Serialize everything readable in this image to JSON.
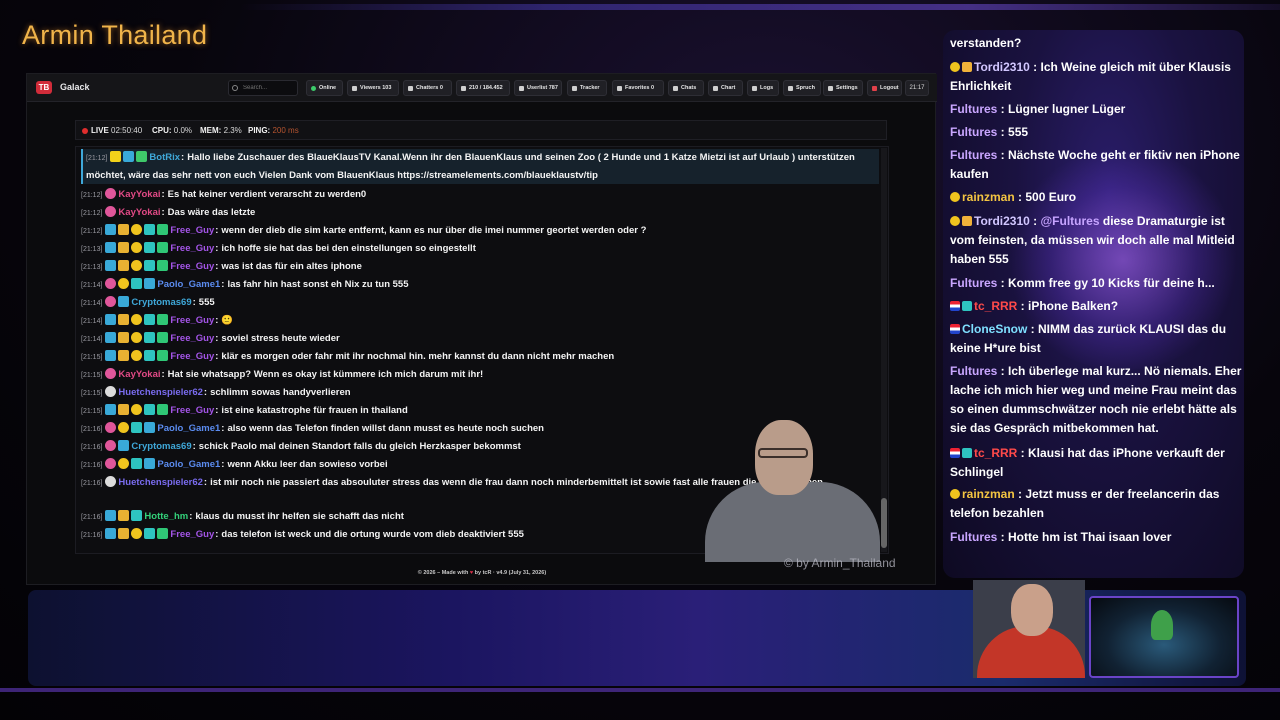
{
  "channel_title": "Armin Thailand",
  "app": {
    "brand": "Galack",
    "search_placeholder": "Search...",
    "toolbar": [
      {
        "label": "Online"
      },
      {
        "label": "Viewers 103"
      },
      {
        "label": "Chatters 0"
      },
      {
        "label": "210 / 184.452"
      },
      {
        "label": "Userlist 787"
      },
      {
        "label": "Tracker"
      },
      {
        "label": "Favorites 0"
      },
      {
        "label": "Chats"
      },
      {
        "label": "Chart"
      },
      {
        "label": "Logs"
      },
      {
        "label": "Spruch"
      },
      {
        "label": "Settings"
      },
      {
        "label": "Logout"
      }
    ],
    "clock": "21:17",
    "status": {
      "live_label": "LIVE",
      "live_value": "02:50:40",
      "cpu_label": "CPU:",
      "cpu_value": "0.0%",
      "mem_label": "MEM:",
      "mem_value": "2.3%",
      "ping_label": "PING:",
      "ping_value": "200 ms"
    },
    "messages": [
      {
        "time": "[21:12]",
        "user": "BotRix",
        "text": "Hallo liebe Zuschauer des BlaueKlausTV Kanal.Wenn ihr den BlauenKlaus und seinen Zoo ( 2 Hunde und 1 Katze Mietzi ist auf Urlaub ) unterstützen möchtet, wäre das sehr nett von euch Vielen Dank vom BlauenKlaus https://streamelements.com/blaueklaustv/tip",
        "color": "#3fa8d9"
      },
      {
        "time": "[21:12]",
        "user": "KayYokai",
        "text": "Es hat keiner verdient verarscht zu werden0",
        "color": "#e24a86"
      },
      {
        "time": "[21:12]",
        "user": "KayYokai",
        "text": "Das wäre das letzte",
        "color": "#e24a86"
      },
      {
        "time": "[21:12]",
        "user": "Free_Guy",
        "text": "wenn der dieb die sim karte entfernt, kann es nur über die imei nummer geortet werden oder ?",
        "color": "#a455e8"
      },
      {
        "time": "[21:13]",
        "user": "Free_Guy",
        "text": "ich hoffe sie hat das bei den einstellungen so eingestellt",
        "color": "#a455e8"
      },
      {
        "time": "[21:13]",
        "user": "Free_Guy",
        "text": "was ist das für ein altes iphone",
        "color": "#a455e8"
      },
      {
        "time": "[21:14]",
        "user": "Paolo_Game1",
        "text": "las fahr hin hast sonst eh Nix zu tun 555",
        "color": "#5b8cf0"
      },
      {
        "time": "[21:14]",
        "user": "Cryptomas69",
        "text": "555",
        "color": "#3fa8d9"
      },
      {
        "time": "[21:14]",
        "user": "Free_Guy",
        "text": "🙂",
        "color": "#a455e8"
      },
      {
        "time": "[21:14]",
        "user": "Free_Guy",
        "text": "soviel stress heute wieder",
        "color": "#a455e8"
      },
      {
        "time": "[21:15]",
        "user": "Free_Guy",
        "text": "klär es morgen oder fahr mit ihr nochmal hin. mehr kannst du dann nicht mehr machen",
        "color": "#a455e8"
      },
      {
        "time": "[21:15]",
        "user": "KayYokai",
        "text": "Hat sie whatsapp? Wenn es okay ist kümmere ich mich darum mit ihr!",
        "color": "#e24a86"
      },
      {
        "time": "[21:15]",
        "user": "Huetchenspieler62",
        "text": "schlimm sowas handyverlieren",
        "color": "#7a6cf0"
      },
      {
        "time": "[21:15]",
        "user": "Free_Guy",
        "text": "ist eine katastrophe für frauen in thailand",
        "color": "#a455e8"
      },
      {
        "time": "[21:16]",
        "user": "Paolo_Game1",
        "text": "also wenn das Telefon finden willst dann musst es heute noch suchen",
        "color": "#5b8cf0"
      },
      {
        "time": "[21:16]",
        "user": "Cryptomas69",
        "text": "schick Paolo mal deinen Standort falls du gleich Herzkasper bekommst",
        "color": "#3fa8d9"
      },
      {
        "time": "[21:16]",
        "user": "Paolo_Game1",
        "text": "wenn Akku leer dan sowieso vorbei",
        "color": "#5b8cf0"
      },
      {
        "time": "[21:16]",
        "user": "Huetchenspieler62",
        "text": "ist mir noch nie passiert das absouluter stress das wenn die frau dann noch minderbemittelt ist sowie fast alle frauen die falangs haben",
        "color": "#7a6cf0"
      },
      {
        "time": "[21:16]",
        "user": "Hotte_hm",
        "text": "klaus du musst ihr helfen sie schafft das nicht",
        "color": "#33d17a"
      },
      {
        "time": "[21:16]",
        "user": "Free_Guy",
        "text": "das telefon ist weck und die ortung wurde vom dieb deaktiviert 555",
        "color": "#a455e8"
      }
    ],
    "footer_left": "© 2026 – Made with",
    "footer_heart": "♥",
    "footer_right": "by tcR · v4.9 (July 31, 2026)"
  },
  "watermark": "© by Armin_Thailand",
  "right_chat": [
    {
      "user": "",
      "text": "verstanden?"
    },
    {
      "user": "Tordi2310",
      "text": "Ich Weine gleich mit über Klausis Ehrlichkeit"
    },
    {
      "user": "Fultures",
      "text": "Lügner lugner Lüger"
    },
    {
      "user": "Fultures",
      "text": "555"
    },
    {
      "user": "Fultures",
      "text": "Nächste Woche geht er fiktiv nen iPhone kaufen"
    },
    {
      "user": "rainzman",
      "text": "500 Euro"
    },
    {
      "user": "Tordi2310",
      "mention": "@Fultures",
      "text": "diese Dramaturgie ist vom feinsten, da müssen wir doch alle mal Mitleid haben 555"
    },
    {
      "user": "Fultures",
      "text": "Komm free gy 10 Kicks für deine h..."
    },
    {
      "user": "tc_RRR",
      "text": "iPhone Balken?"
    },
    {
      "user": "CloneSnow",
      "text": "NIMM das zurück KLAUSI das du keine H*ure bist"
    },
    {
      "user": "Fultures",
      "text": "Ich überlege mal kurz... Nö niemals. Eher lache ich mich hier weg und meine Frau meint das so einen dummschwätzer noch nie erlebt hätte als sie das Gespräch mitbekommen hat."
    },
    {
      "user": "tc_RRR",
      "text": "Klausi hat das iPhone verkauft der Schlingel"
    },
    {
      "user": "rainzman",
      "text": "Jetzt muss er der freelancerin das telefon bezahlen"
    },
    {
      "user": "Fultures",
      "text": "Hotte hm ist Thai isaan lover"
    }
  ]
}
